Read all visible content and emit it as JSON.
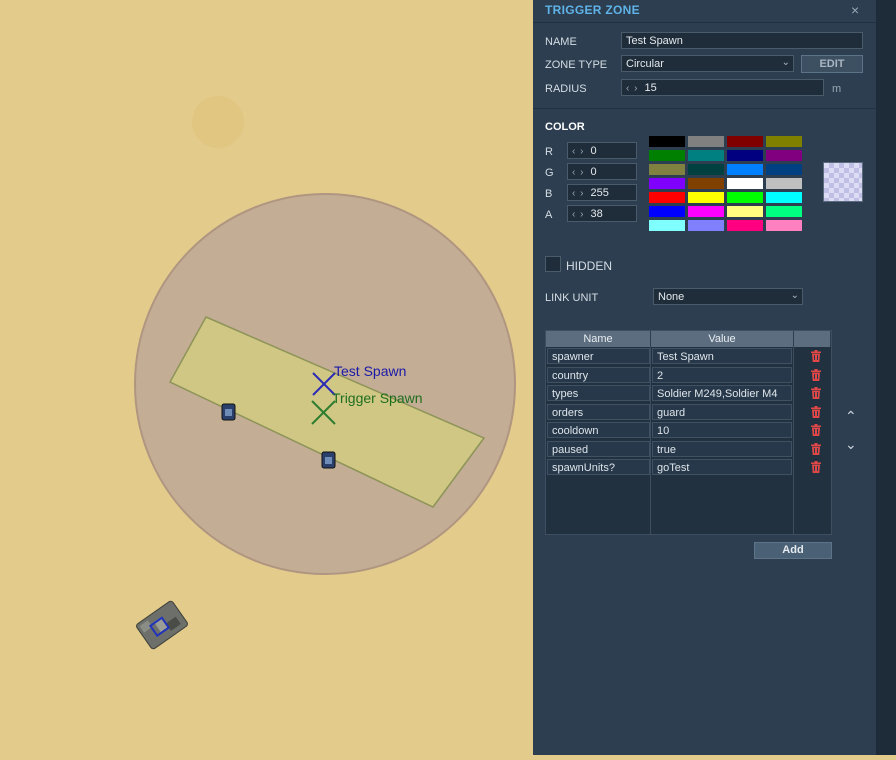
{
  "map": {
    "zone_labels": [
      {
        "text": "Test Spawn",
        "color": "#1a1aa8"
      },
      {
        "text": "Trigger Spawn",
        "color": "#1f6e1f"
      }
    ]
  },
  "panel": {
    "title": "TRIGGER ZONE",
    "close_glyph": "×",
    "name_label": "NAME",
    "name_value": "Test Spawn",
    "zone_type_label": "ZONE TYPE",
    "zone_type_value": "Circular",
    "edit_button": "EDIT",
    "radius_label": "RADIUS",
    "radius_value": "15",
    "radius_unit": "m",
    "color_header": "COLOR",
    "color_channels": [
      {
        "label": "R",
        "value": "0"
      },
      {
        "label": "G",
        "value": "0"
      },
      {
        "label": "B",
        "value": "255"
      },
      {
        "label": "A",
        "value": "38"
      }
    ],
    "palette": [
      "#000000",
      "#808080",
      "#800000",
      "#808000",
      "#008000",
      "#008080",
      "#000080",
      "#800080",
      "#808040",
      "#004040",
      "#0080ff",
      "#004080",
      "#8000ff",
      "#804000",
      "#ffffff",
      "#c0c0c0",
      "#ff0000",
      "#ffff00",
      "#00ff00",
      "#00ffff",
      "#0000ff",
      "#ff00ff",
      "#ffff80",
      "#00ff80",
      "#80ffff",
      "#8080ff",
      "#ff0080",
      "#ff80c0"
    ],
    "hidden_label": "HIDDEN",
    "link_unit_label": "LINK UNIT",
    "link_unit_value": "None",
    "table": {
      "headers": [
        "Name",
        "Value"
      ],
      "rows": [
        {
          "name": "spawner",
          "value": "Test Spawn"
        },
        {
          "name": "country",
          "value": "2"
        },
        {
          "name": "types",
          "value": "Soldier M249,Soldier M4"
        },
        {
          "name": "orders",
          "value": "guard"
        },
        {
          "name": "cooldown",
          "value": "10"
        },
        {
          "name": "paused",
          "value": "true"
        },
        {
          "name": "spawnUnits?",
          "value": "goTest"
        }
      ]
    },
    "add_button": "Add",
    "icons": {
      "close": "close-icon",
      "delete": "trash-icon",
      "move_up": "chevron-up-icon",
      "move_down": "chevron-down-icon",
      "dropdown": "chevron-down-icon"
    },
    "colors": {
      "title": "#5fb3e8",
      "trash": "#e04848",
      "panel_bg": "#2c3e50"
    }
  }
}
